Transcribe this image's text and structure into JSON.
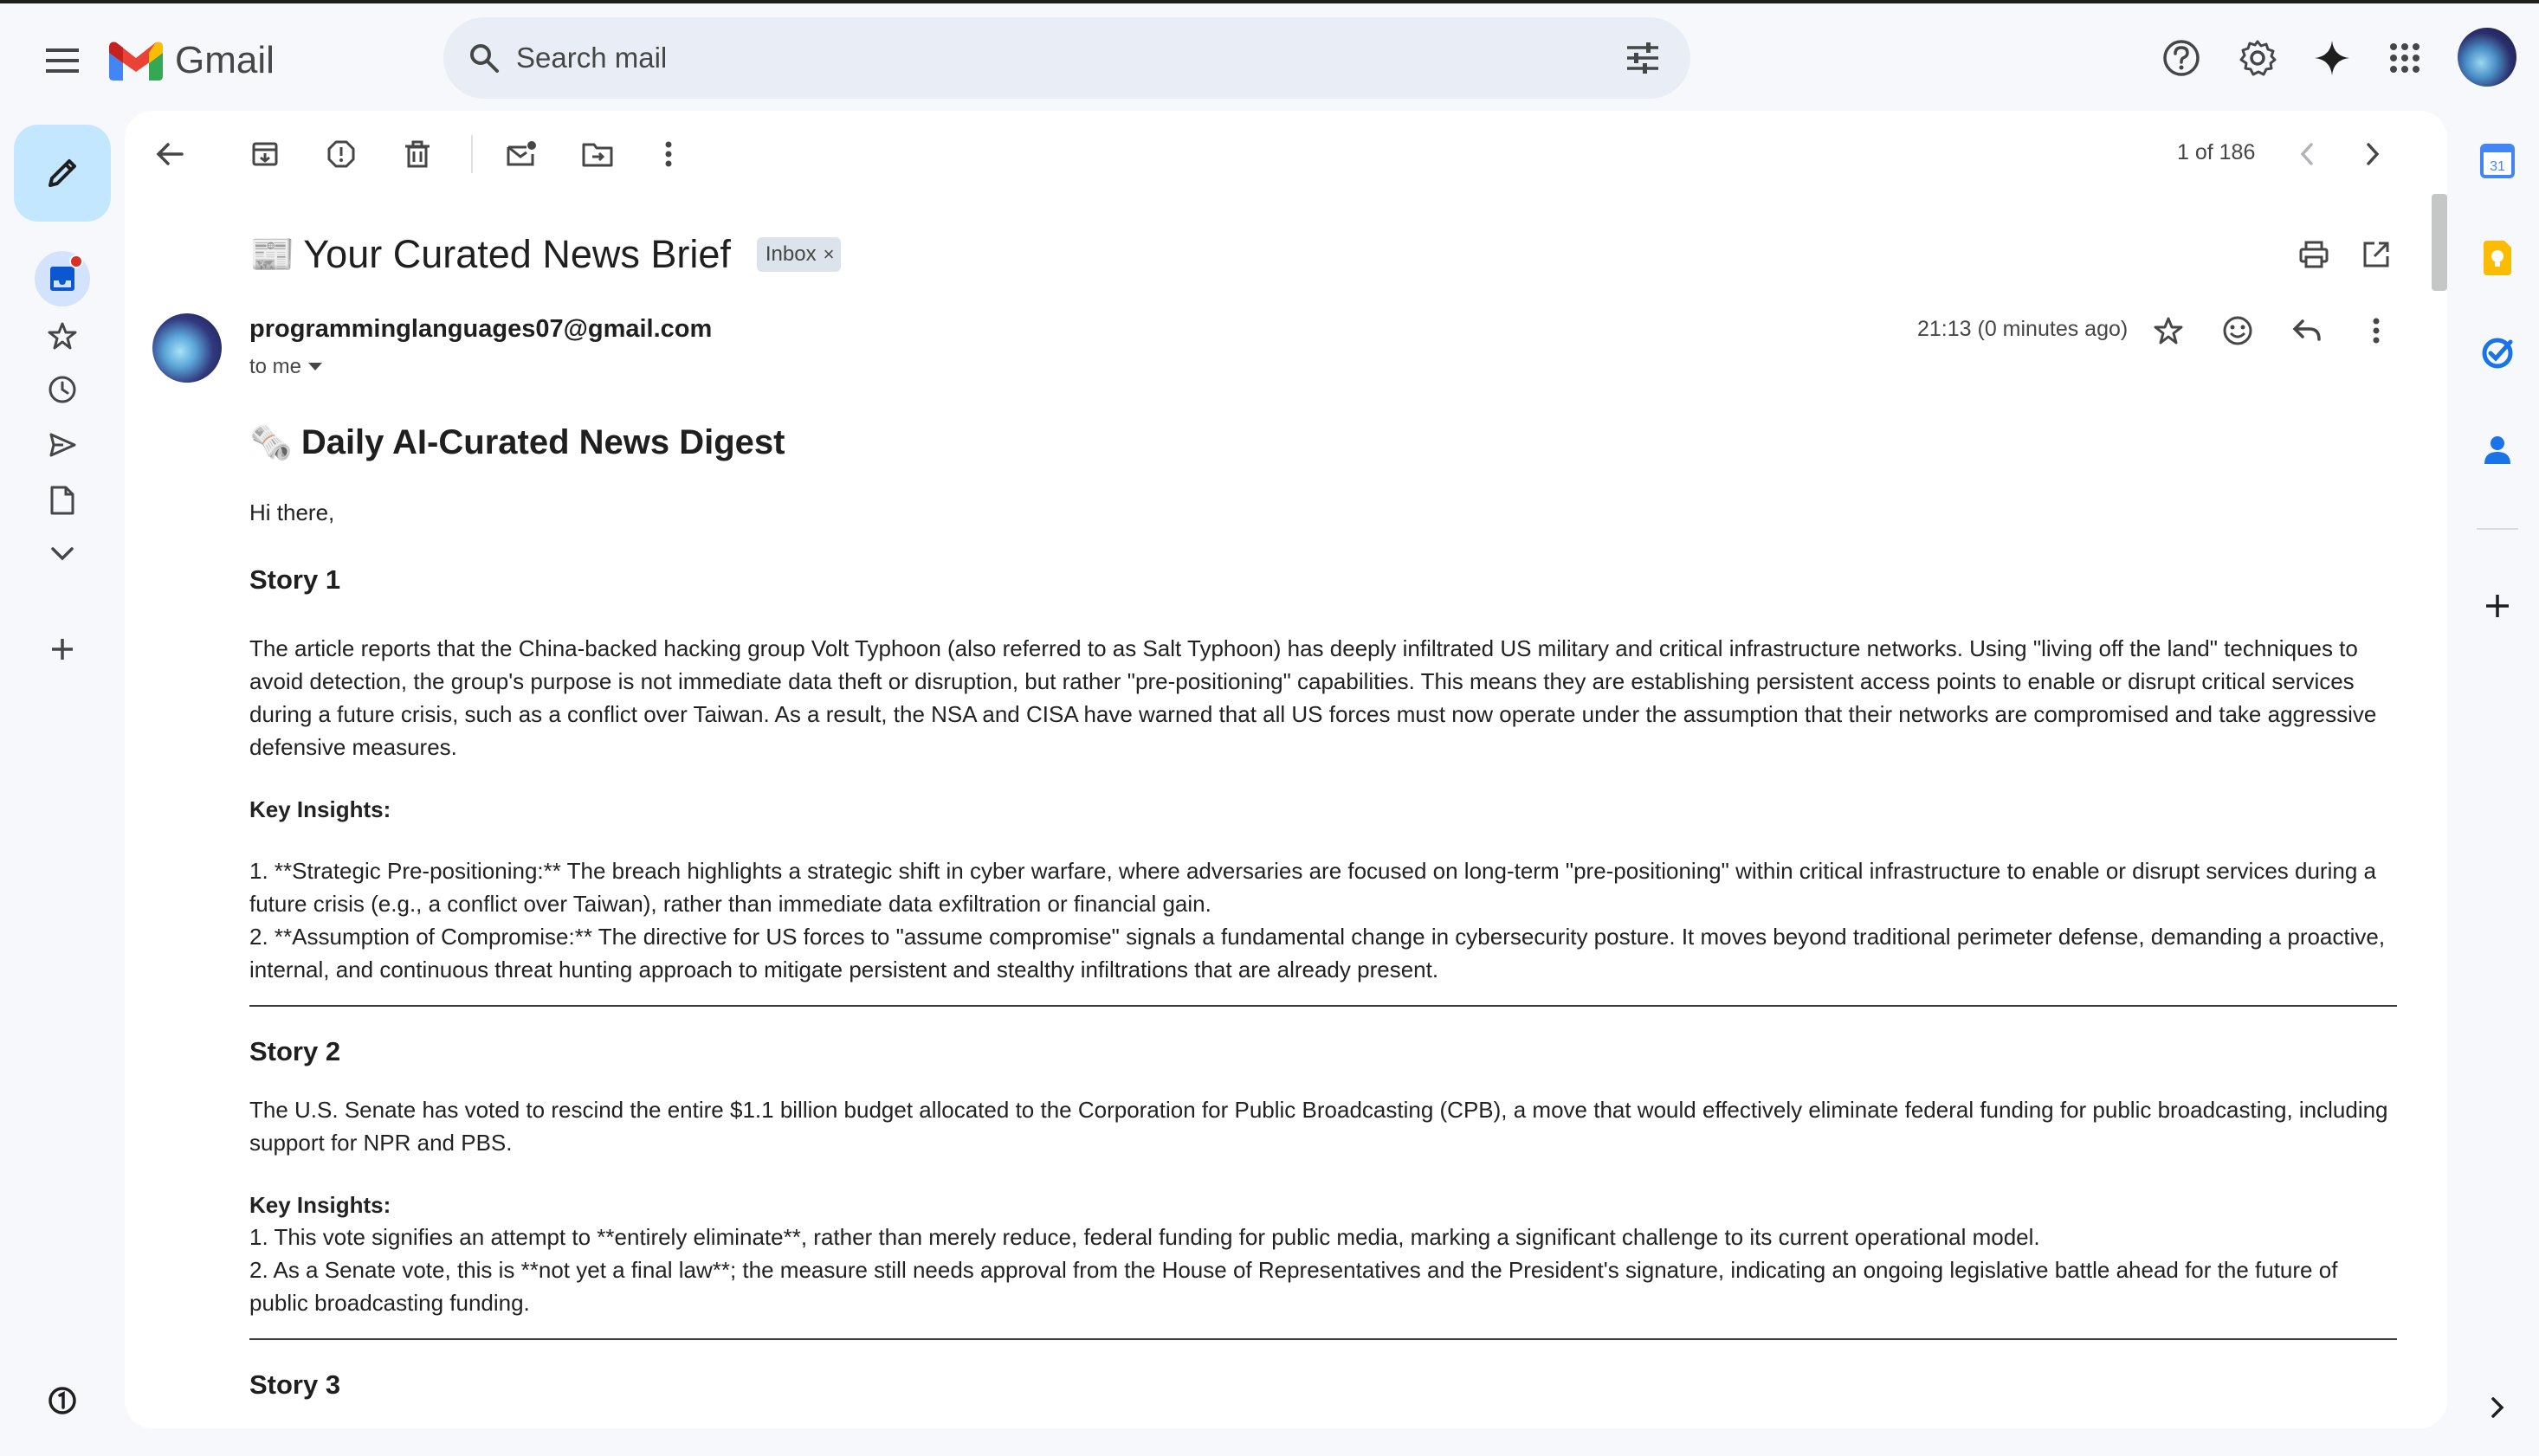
{
  "app": {
    "name": "Gmail"
  },
  "search": {
    "placeholder": "Search mail"
  },
  "toolbar": {
    "pager": "1 of 186"
  },
  "email": {
    "subject_emoji": "📰",
    "subject": "Your Curated News Brief",
    "label_chip": "Inbox",
    "chip_close": "×",
    "sender": "programminglanguages07@gmail.com",
    "to": "to me",
    "timestamp": "21:13 (0 minutes ago)"
  },
  "body": {
    "heading_emoji": "🗞️",
    "heading": "Daily AI-Curated News Digest",
    "greeting": "Hi there,",
    "stories": [
      {
        "title": "Story 1",
        "summary": "The article reports that the China-backed hacking group Volt Typhoon (also referred to as Salt Typhoon) has deeply infiltrated US military and critical infrastructure networks. Using \"living off the land\" techniques to avoid detection, the group's purpose is not immediate data theft or disruption, but rather \"pre-positioning\" capabilities. This means they are establishing persistent access points to enable or disrupt critical services during a future crisis, such as a conflict over Taiwan. As a result, the NSA and CISA have warned that all US forces must now operate under the assumption that their networks are compromised and take aggressive defensive measures.",
        "insights_label": "Key Insights:",
        "insights": [
          "1. **Strategic Pre-positioning:** The breach highlights a strategic shift in cyber warfare, where adversaries are focused on long-term \"pre-positioning\" within critical infrastructure to enable or disrupt services during a future crisis (e.g., a conflict over Taiwan), rather than immediate data exfiltration or financial gain.",
          "2. **Assumption of Compromise:** The directive for US forces to \"assume compromise\" signals a fundamental change in cybersecurity posture. It moves beyond traditional perimeter defense, demanding a proactive, internal, and continuous threat hunting approach to mitigate persistent and stealthy infiltrations that are already present."
        ]
      },
      {
        "title": "Story 2",
        "summary": "The U.S. Senate has voted to rescind the entire $1.1 billion budget allocated to the Corporation for Public Broadcasting (CPB), a move that would effectively eliminate federal funding for public broadcasting, including support for NPR and PBS.",
        "insights_label": "Key Insights:",
        "insights": [
          "1. This vote signifies an attempt to **entirely eliminate**, rather than merely reduce, federal funding for public media, marking a significant challenge to its current operational model.",
          "2. As a Senate vote, this is **not yet a final law**; the measure still needs approval from the House of Representatives and the President's signature, indicating an ongoing legislative battle ahead for the future of public broadcasting funding."
        ]
      },
      {
        "title": "Story 3"
      }
    ]
  },
  "colors": {
    "accent_compose": "#c2e7ff",
    "nav_active": "#d3e3fd",
    "unread_dot": "#d93025",
    "gmail_red": "#ea4335",
    "gmail_blue": "#4285f4",
    "gmail_green": "#34a853",
    "gmail_yellow": "#fbbc04"
  },
  "right_rail": {
    "calendar_day": "31"
  }
}
